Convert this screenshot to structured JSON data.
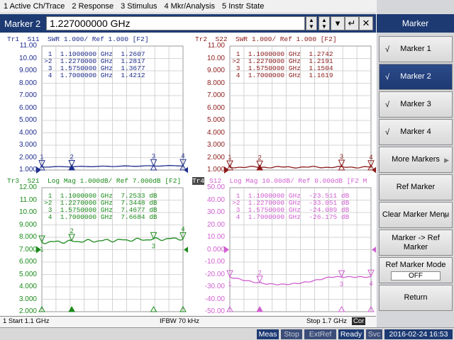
{
  "menubar": [
    "1 Active Ch/Trace",
    "2 Response",
    "3 Stimulus",
    "4 Mkr/Analysis",
    "5 Instr State"
  ],
  "entry": {
    "label": "Marker 2",
    "value": "1.227000000 GHz"
  },
  "softkeys": {
    "title": "Marker",
    "items": [
      {
        "label": "Marker 1",
        "check": "√",
        "arrow": ""
      },
      {
        "label": "Marker 2",
        "check": "√",
        "arrow": "",
        "selected": true
      },
      {
        "label": "Marker 3",
        "check": "√",
        "arrow": ""
      },
      {
        "label": "Marker 4",
        "check": "√",
        "arrow": ""
      },
      {
        "label": "More Markers",
        "check": "",
        "arrow": "▶"
      },
      {
        "label": "Ref Marker",
        "check": "",
        "arrow": ""
      },
      {
        "label": "Clear Marker Menu",
        "check": "",
        "arrow": "▶"
      },
      {
        "label": "Marker -> Ref Marker",
        "check": "",
        "arrow": ""
      },
      {
        "label": "Ref Marker Mode",
        "check": "",
        "arrow": "",
        "value": "OFF"
      },
      {
        "label": "Return",
        "check": "",
        "arrow": ""
      }
    ]
  },
  "traces": [
    {
      "id": "tr1",
      "title": "Tr1  S11  SWR 1.000/ Ref 1.000 [F2]",
      "color": "#1e2d8c",
      "yticks": [
        "11.00",
        "10.00",
        "9.000",
        "8.000",
        "7.000",
        "6.000",
        "5.000",
        "4.000",
        "3.000",
        "2.000",
        "1.000"
      ],
      "markers": [
        {
          "n": "1",
          "freq": "1.1000000 GHz",
          "val": "1.2607",
          "active": false
        },
        {
          "n": "2",
          "freq": "1.2270000 GHz",
          "val": "1.2817",
          "active": true
        },
        {
          "n": "3",
          "freq": "1.5750000 GHz",
          "val": "1.3677",
          "active": false
        },
        {
          "n": "4",
          "freq": "1.7000000 GHz",
          "val": "1.4212",
          "active": false
        }
      ]
    },
    {
      "id": "tr2",
      "title": "Tr2  S22  SWR 1.000/ Ref 1.000 [F2]",
      "color": "#8b1a1a",
      "yticks": [
        "11.00",
        "10.00",
        "9.000",
        "8.000",
        "7.000",
        "6.000",
        "5.000",
        "4.000",
        "3.000",
        "2.000",
        "1.000"
      ],
      "markers": [
        {
          "n": "1",
          "freq": "1.1000000 GHz",
          "val": "1.2742",
          "active": false
        },
        {
          "n": "2",
          "freq": "1.2270000 GHz",
          "val": "1.2191",
          "active": true
        },
        {
          "n": "3",
          "freq": "1.5750000 GHz",
          "val": "1.1504",
          "active": false
        },
        {
          "n": "4",
          "freq": "1.7000000 GHz",
          "val": "1.1619",
          "active": false
        }
      ]
    },
    {
      "id": "tr3",
      "title": "Tr3  S21  Log Mag 1.000dB/ Ref 7.000dB [F2]",
      "color": "#1b8a1b",
      "yticks": [
        "12.00",
        "11.00",
        "10.00",
        "9.000",
        "8.000",
        "7.000",
        "6.000",
        "5.000",
        "4.000",
        "3.000",
        "2.000"
      ],
      "markers": [
        {
          "n": "1",
          "freq": "1.1000000 GHz",
          "val": "7.2533 dB",
          "active": false
        },
        {
          "n": "2",
          "freq": "1.2270000 GHz",
          "val": "7.3448 dB",
          "active": true
        },
        {
          "n": "3",
          "freq": "1.5750000 GHz",
          "val": "7.4677 dB",
          "active": false
        },
        {
          "n": "4",
          "freq": "1.7000000 GHz",
          "val": "7.6684 dB",
          "active": false
        }
      ]
    },
    {
      "id": "tr4",
      "title": "S12  Log Mag 10.00dB/ Ref 0.000dB [F2 M",
      "badge": "Tr4",
      "color": "#d060d0",
      "yticks": [
        "50.00",
        "40.00",
        "30.00",
        "20.00",
        "10.00",
        "0.000",
        "-10.00",
        "-20.00",
        "-30.00",
        "-40.00",
        "-50.00"
      ],
      "markers": [
        {
          "n": "1",
          "freq": "1.1000000 GHz",
          "val": "-23.511 dB",
          "active": false
        },
        {
          "n": "2",
          "freq": "1.2270000 GHz",
          "val": "-33.051 dB",
          "active": true
        },
        {
          "n": "3",
          "freq": "1.5750000 GHz",
          "val": "-24.089 dB",
          "active": false
        },
        {
          "n": "4",
          "freq": "1.7000000 GHz",
          "val": "-26.175 dB",
          "active": false
        }
      ]
    }
  ],
  "channelbar": {
    "start": "1  Start 1.1 GHz",
    "ifbw": "IFBW 70 kHz",
    "stop": "Stop 1.7 GHz",
    "cor": "Cor"
  },
  "statusbar": {
    "meas": "Meas",
    "stop": "Stop",
    "extref": "ExtRef",
    "ready": "Ready",
    "svc": "Svc",
    "datetime": "2016-02-24 16:53"
  }
}
